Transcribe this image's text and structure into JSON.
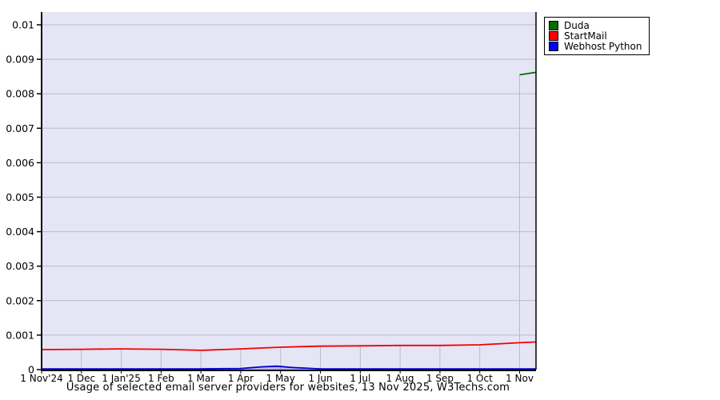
{
  "chart_data": {
    "type": "line",
    "title": "Usage of selected email server providers for websites, 13 Nov 2025, W3Techs.com",
    "x": {
      "tick_positions": [
        0,
        1,
        2,
        3,
        4,
        5,
        6,
        7,
        8,
        9,
        10,
        11,
        12
      ],
      "tick_labels": [
        "1 Nov'24",
        "1 Dec",
        "1 Jan'25",
        "1 Feb",
        "1 Mar",
        "1 Apr",
        "1 May",
        "1 Jun",
        "1 Jul",
        "1 Aug",
        "1 Sep",
        "1 Oct",
        "1 Nov"
      ],
      "min": 0,
      "max": 12.4
    },
    "y": {
      "ticks": [
        0,
        0.001,
        0.002,
        0.003,
        0.004,
        0.005,
        0.006,
        0.007,
        0.008,
        0.009,
        0.01
      ],
      "tick_labels": [
        "0",
        "0.001",
        "0.002",
        "0.003",
        "0.004",
        "0.005",
        "0.006",
        "0.007",
        "0.008",
        "0.009",
        "0.01"
      ],
      "min": 0,
      "max": 0.01037
    },
    "grid": true,
    "legend_position": "outside-top-right",
    "colors": {
      "plot_bg": "#e5e5f5",
      "grid": "#bbbbc6",
      "axis": "#000000",
      "text": "#000000"
    },
    "series": [
      {
        "name": "Duda",
        "color": "#006e00",
        "points": [
          [
            12,
            0.00855
          ],
          [
            12.4,
            0.00862
          ]
        ]
      },
      {
        "name": "StartMail",
        "color": "#ff0000",
        "line_color": "#f40000",
        "points": [
          [
            0,
            0.00058
          ],
          [
            1,
            0.00059
          ],
          [
            2,
            0.0006
          ],
          [
            3,
            0.00059
          ],
          [
            4,
            0.00056
          ],
          [
            5,
            0.0006
          ],
          [
            6,
            0.00065
          ],
          [
            7,
            0.00068
          ],
          [
            8,
            0.00069
          ],
          [
            9,
            0.0007
          ],
          [
            10,
            0.0007
          ],
          [
            11,
            0.00072
          ],
          [
            12,
            0.00078
          ],
          [
            12.4,
            0.0008
          ]
        ]
      },
      {
        "name": "Webhost Python",
        "color": "#0000ff",
        "line_color": "#0000c8",
        "fill_color": "rgba(90,90,220,0.35)",
        "points": [
          [
            0,
            2e-05
          ],
          [
            1,
            2e-05
          ],
          [
            2,
            2e-05
          ],
          [
            3,
            2e-05
          ],
          [
            4,
            2e-05
          ],
          [
            5,
            3e-05
          ],
          [
            5.5,
            8e-05
          ],
          [
            5.9,
            0.0001
          ],
          [
            6.3,
            6e-05
          ],
          [
            7,
            2e-05
          ],
          [
            8,
            2e-05
          ],
          [
            9,
            2e-05
          ],
          [
            10,
            2e-05
          ],
          [
            11,
            2e-05
          ],
          [
            12,
            2e-05
          ],
          [
            12.4,
            2e-05
          ]
        ]
      }
    ]
  }
}
